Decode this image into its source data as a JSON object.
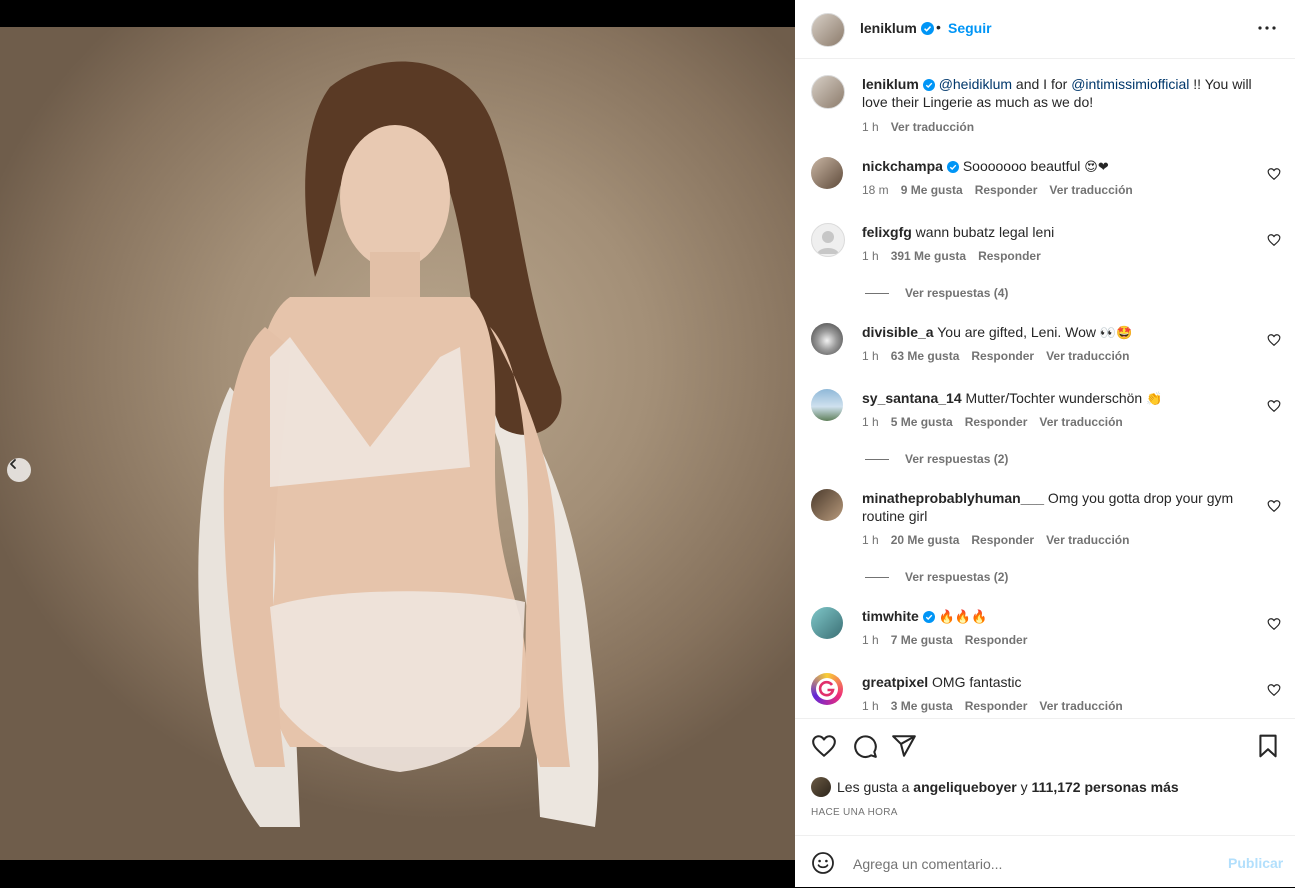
{
  "post": {
    "author": "leniklum",
    "follow_label": "Seguir",
    "separator": "•"
  },
  "caption": {
    "username": "leniklum",
    "mention1": "@heidiklum",
    "mid_text": " and I for ",
    "mention2": "@intimissimiofficial",
    "end_text": " !! You will love their Lingerie as much as we do!",
    "time": "1 h",
    "translate": "Ver traducción"
  },
  "comments": [
    {
      "username": "nickchampa",
      "text": " Sooooooo beautful ",
      "emoji": "😍❤",
      "time": "18 m",
      "likes": "9 Me gusta",
      "reply": "Responder",
      "translate": "Ver traducción"
    },
    {
      "username": "felixgfg",
      "text": " wann bubatz legal leni",
      "emoji": "",
      "time": "1 h",
      "likes": "391 Me gusta",
      "reply": "Responder",
      "translate": ""
    },
    {
      "username": "divisible_a",
      "text": " You are gifted, Leni. Wow ",
      "emoji": "👀🤩",
      "time": "1 h",
      "likes": "63 Me gusta",
      "reply": "Responder",
      "translate": "Ver traducción"
    },
    {
      "username": "sy_santana_14",
      "text": " Mutter/Tochter wunderschön ",
      "emoji": "👏",
      "time": "1 h",
      "likes": "5 Me gusta",
      "reply": "Responder",
      "translate": "Ver traducción"
    },
    {
      "username": "minatheprobablyhuman___",
      "text": " Omg you gotta drop your gym routine girl",
      "emoji": "",
      "time": "1 h",
      "likes": "20 Me gusta",
      "reply": "Responder",
      "translate": "Ver traducción"
    },
    {
      "username": "timwhite",
      "text": " ",
      "emoji": "🔥🔥🔥",
      "time": "1 h",
      "likes": "7 Me gusta",
      "reply": "Responder",
      "translate": ""
    },
    {
      "username": "greatpixel",
      "text": " OMG fantastic",
      "emoji": "",
      "time": "1 h",
      "likes": "3 Me gusta",
      "reply": "Responder",
      "translate": "Ver traducción"
    }
  ],
  "replies": {
    "felixgfg": "Ver respuestas (4)",
    "sy_santana_14": "Ver respuestas (2)",
    "minatheprobablyhuman___": "Ver respuestas (2)"
  },
  "likes_summary": {
    "prefix": "Les gusta a ",
    "user": "angeliqueboyer",
    "middle": " y ",
    "count": "111,172 personas más"
  },
  "posted_ago": "HACE UNA HORA",
  "comment_box": {
    "placeholder": "Agrega un comentario...",
    "publish_label": "Publicar"
  },
  "icons": {
    "more": "more-options-icon",
    "like": "heart-icon",
    "comment": "comment-icon",
    "share": "share-icon",
    "save": "bookmark-icon",
    "emoji": "emoji-icon",
    "prev": "chevron-left-icon"
  },
  "colors": {
    "accent": "#0095f6",
    "verified": "#0095f6",
    "mention": "#00376b",
    "publish_disabled": "#b2dffc",
    "muted": "#737373"
  }
}
